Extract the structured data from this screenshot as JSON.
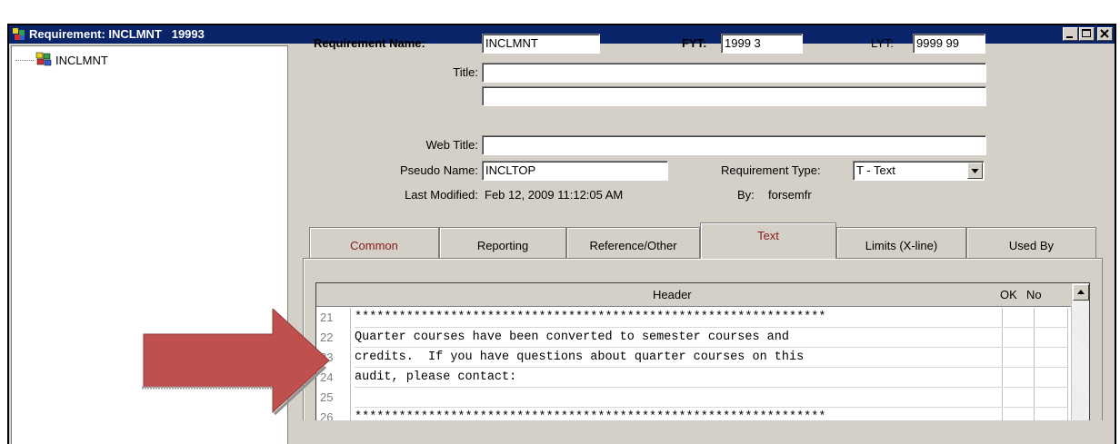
{
  "window": {
    "title": "Requirement: INCLMNT   19993",
    "buttons": [
      "minimize",
      "maximize",
      "close"
    ]
  },
  "tree": {
    "root_label": "INCLMNT",
    "root_icon": "requirement-tree-icon"
  },
  "form": {
    "requirement_name_label": "Requirement Name:",
    "requirement_name_value": "INCLMNT",
    "fyt_label": "FYT:",
    "fyt_value": "1999 3",
    "lyt_label": "LYT:",
    "lyt_value": "9999 99",
    "title_label": "Title:",
    "title_value": "",
    "title2_value": "",
    "web_title_label": "Web Title:",
    "web_title_value": "",
    "pseudo_name_label": "Pseudo Name:",
    "pseudo_name_value": "INCLTOP",
    "requirement_type_label": "Requirement Type:",
    "requirement_type_value": "T - Text",
    "last_modified_label": "Last Modified:",
    "last_modified_value": "Feb 12, 2009  11:12:05 AM",
    "by_label": "By:",
    "by_value": "forsemfr"
  },
  "tabs": [
    {
      "label": "Common",
      "color": "#8b1a1a"
    },
    {
      "label": "Reporting",
      "color": "#000000"
    },
    {
      "label": "Reference/Other",
      "color": "#000000"
    },
    {
      "label": "Text",
      "color": "#8b1a1a"
    },
    {
      "label": "Limits (X-line)",
      "color": "#000000"
    },
    {
      "label": "Used By",
      "color": "#000000"
    }
  ],
  "active_tab": "Text",
  "grid": {
    "columns": [
      "Header",
      "OK",
      "No"
    ],
    "rows": [
      {
        "num": "21",
        "text": "****************************************************************"
      },
      {
        "num": "22",
        "text": "Quarter courses have been converted to semester courses and"
      },
      {
        "num": "23",
        "text": "credits.  If you have questions about quarter courses on this"
      },
      {
        "num": "24",
        "text": "audit, please contact:"
      },
      {
        "num": "25",
        "text": ""
      },
      {
        "num": "26",
        "text": "****************************************************************"
      }
    ]
  },
  "colors": {
    "titlebar": "#0a246a",
    "window_bg": "#d4d0c8",
    "arrow": "#c0504d"
  }
}
